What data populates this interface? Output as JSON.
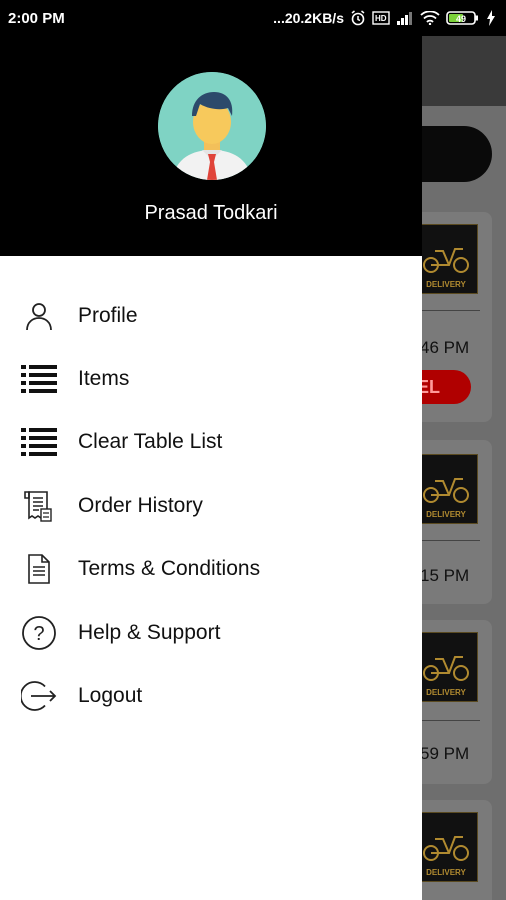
{
  "status_bar": {
    "time": "2:00 PM",
    "network_speed": "...20.2KB/s",
    "battery": "49"
  },
  "drawer": {
    "user": {
      "name": "Prasad Todkari"
    },
    "menu": [
      {
        "label": "Profile",
        "icon": "person-icon"
      },
      {
        "label": "Items",
        "icon": "list-icon"
      },
      {
        "label": "Clear Table List",
        "icon": "list-icon"
      },
      {
        "label": "Order History",
        "icon": "receipt-icon"
      },
      {
        "label": "Terms & Conditions",
        "icon": "document-icon"
      },
      {
        "label": "Help & Support",
        "icon": "help-icon"
      },
      {
        "label": "Logout",
        "icon": "logout-icon"
      }
    ]
  },
  "background": {
    "cards": [
      {
        "time": "46 PM",
        "cancel": "EL",
        "badge": "DELIVERY"
      },
      {
        "time": "15 PM",
        "badge": "DELIVERY"
      },
      {
        "time": "59 PM",
        "badge": "DELIVERY"
      },
      {
        "badge": "DELIVERY"
      }
    ]
  }
}
